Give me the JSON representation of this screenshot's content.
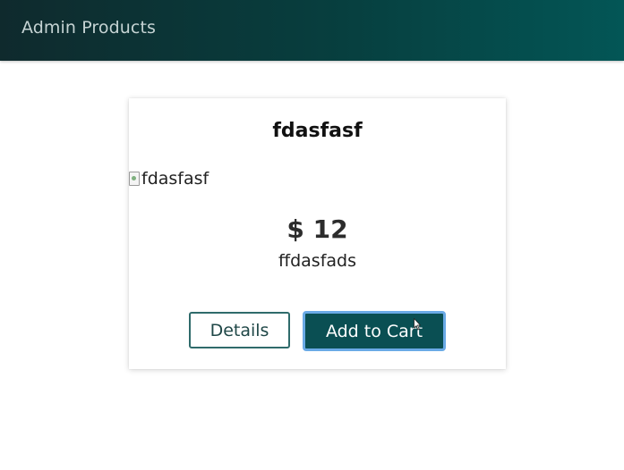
{
  "header": {
    "title": "Admin Products"
  },
  "product": {
    "title": "fdasfasf",
    "image_alt": "fdasfasf",
    "price": "$ 12",
    "description": "ffdasfads"
  },
  "actions": {
    "details_label": "Details",
    "add_to_cart_label": "Add to Cart"
  },
  "colors": {
    "header_start": "#0f2a2d",
    "header_end": "#035656",
    "primary": "#0a4f53",
    "focus_ring": "#6aaae6"
  },
  "icons": {
    "cursor": "mouse-pointer-icon",
    "broken_image": "broken-image-icon"
  }
}
